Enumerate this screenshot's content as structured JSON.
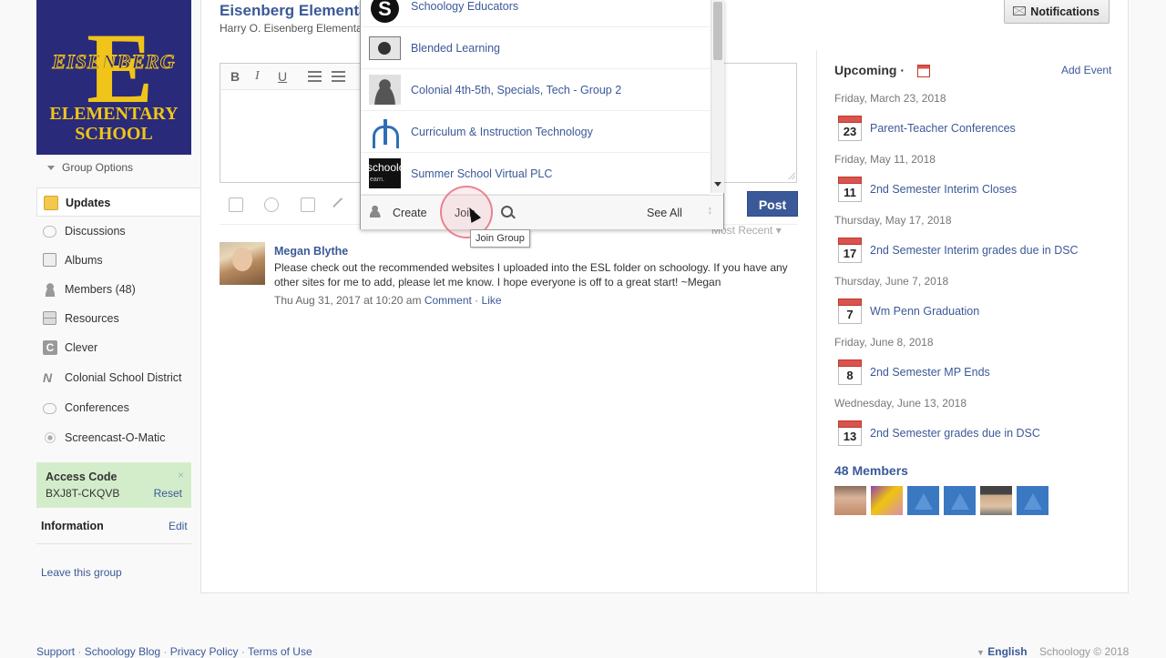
{
  "sidebar": {
    "logo": {
      "letter": "E",
      "line1": "EISENBERG",
      "line2": "ELEMENTARY\nSCHOOL"
    },
    "group_options": "Group Options",
    "nav": [
      {
        "label": "Updates",
        "icon": "updates-icon",
        "active": true
      },
      {
        "label": "Discussions",
        "icon": "discussions-icon"
      },
      {
        "label": "Albums",
        "icon": "albums-icon"
      },
      {
        "label": "Members (48)",
        "icon": "members-icon"
      },
      {
        "label": "Resources",
        "icon": "resources-icon"
      },
      {
        "label": "Clever",
        "icon": "clever-icon"
      },
      {
        "label": "Colonial School District",
        "icon": "district-icon"
      },
      {
        "label": "Conferences",
        "icon": "conferences-icon"
      },
      {
        "label": "Screencast-O-Matic",
        "icon": "screencast-icon"
      }
    ],
    "access_code": {
      "title": "Access Code",
      "code": "BXJ8T-CKQVB",
      "reset": "Reset",
      "close": "×"
    },
    "information": {
      "title": "Information",
      "edit": "Edit"
    },
    "leave": "Leave this group"
  },
  "header": {
    "title": "Eisenberg Elementa",
    "subtitle": "Harry O. Eisenberg Elementa",
    "notifications": "Notifications"
  },
  "editor": {
    "bold": "B",
    "italic": "I",
    "underline": "U",
    "post": "Post",
    "sort": "Most Recent"
  },
  "post": {
    "author": "Megan Blythe",
    "text": "Please check out the recommended websites I uploaded into the ESL folder on schoology.  If you have any other sites for me to add, please let me know.  I hope everyone is off to a great start! ~Megan",
    "date": "Thu Aug 31, 2017 at 10:20 am",
    "comment": "Comment",
    "sep": "·",
    "like": "Like"
  },
  "groups_dropdown": {
    "items": [
      {
        "label": "Schoology Educators",
        "icon": "schoology-logo-icon"
      },
      {
        "label": "Blended Learning",
        "icon": "blended-learning-icon"
      },
      {
        "label": "Colonial 4th-5th, Specials, Tech - Group 2",
        "icon": "group-silhouette-icon"
      },
      {
        "label": "Curriculum & Instruction Technology",
        "icon": "curriculum-logo-icon"
      },
      {
        "label": "Summer School Virtual PLC",
        "icon": "schoology-learn-icon"
      }
    ],
    "create": "Create",
    "join": "Join",
    "see_all": "See All",
    "tooltip": "Join Group"
  },
  "upcoming": {
    "title": "Upcoming ·",
    "add_event": "Add Event",
    "events": [
      {
        "date": "Friday, March 23, 2018",
        "day": "23",
        "title": "Parent-Teacher Conferences"
      },
      {
        "date": "Friday, May 11, 2018",
        "day": "11",
        "title": "2nd Semester Interim Closes"
      },
      {
        "date": "Thursday, May 17, 2018",
        "day": "17",
        "title": "2nd Semester Interim grades due in DSC"
      },
      {
        "date": "Thursday, June 7, 2018",
        "day": "7",
        "title": "Wm Penn Graduation"
      },
      {
        "date": "Friday, June 8, 2018",
        "day": "8",
        "title": "2nd Semester MP Ends"
      },
      {
        "date": "Wednesday, June 13, 2018",
        "day": "13",
        "title": "2nd Semester grades due in DSC"
      }
    ]
  },
  "members": {
    "title": "48 Members"
  },
  "footer": {
    "links": [
      "Support",
      "Schoology Blog",
      "Privacy Policy",
      "Terms of Use"
    ],
    "sep": "·",
    "language": "English",
    "copyright": "Schoology © 2018"
  },
  "colors": {
    "accent": "#3b5998",
    "access_bg": "#d3edcb",
    "calendar_red": "#d9534f"
  }
}
